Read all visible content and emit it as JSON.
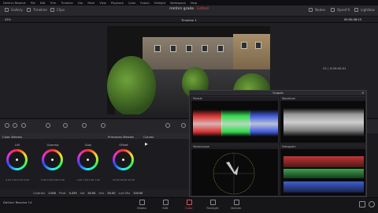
{
  "menubar": [
    "DaVinci Resolve",
    "File",
    "Edit",
    "Trim",
    "Timeline",
    "Clip",
    "Mark",
    "View",
    "Playback",
    "Color",
    "Fusion",
    "Fairlight",
    "Workspace",
    "Help"
  ],
  "pagebar": {
    "gallery": "Gallery",
    "timeline": "Timeline",
    "clips": "Clips",
    "project_title": "mmhrs grade",
    "edited_label": "Edited",
    "nodes": "Nodes",
    "openfx": "OpenFX",
    "lightbox": "Lightbox"
  },
  "subbar": {
    "zoom": "43%",
    "timeline_name": "Timeline 1",
    "timecode": "00:00:48:15"
  },
  "viewer": {
    "clip_label": "V1 | 0:00:00:01",
    "timecode_right": "43:03"
  },
  "color_wheels": {
    "header": "Color Wheels",
    "mode": "Primaries Wheels",
    "curves": "Curves",
    "wheels": [
      {
        "name": "Lift",
        "values": "0.00  0.00  0.00  0.00"
      },
      {
        "name": "Gamma",
        "values": "0.00  0.00  0.00  0.00"
      },
      {
        "name": "Gain",
        "values": "1.00  1.00  1.00  1.00"
      },
      {
        "name": "Offset",
        "values": "25.00  25.00  25.00"
      }
    ]
  },
  "adjustments": [
    {
      "label": "Contrast",
      "value": "1.000"
    },
    {
      "label": "Pivot",
      "value": "0.435"
    },
    {
      "label": "Sat",
      "value": "50.00"
    },
    {
      "label": "Hue",
      "value": "50.00"
    },
    {
      "label": "Lum Mix",
      "value": "100.00"
    }
  ],
  "scopes": {
    "title": "Scopes",
    "parade": "Parade",
    "waveform": "Waveform",
    "vectorscope": "Vectorscope",
    "histogram": "Histogram"
  },
  "pages": [
    {
      "label": "Media",
      "active": false
    },
    {
      "label": "Edit",
      "active": false
    },
    {
      "label": "Color",
      "active": true
    },
    {
      "label": "Fairlight",
      "active": false
    },
    {
      "label": "Deliver",
      "active": false
    }
  ],
  "app_name": "DaVinci Resolve 14",
  "colors": {
    "accent": "#e34f5a",
    "panel": "#1c1c20"
  }
}
